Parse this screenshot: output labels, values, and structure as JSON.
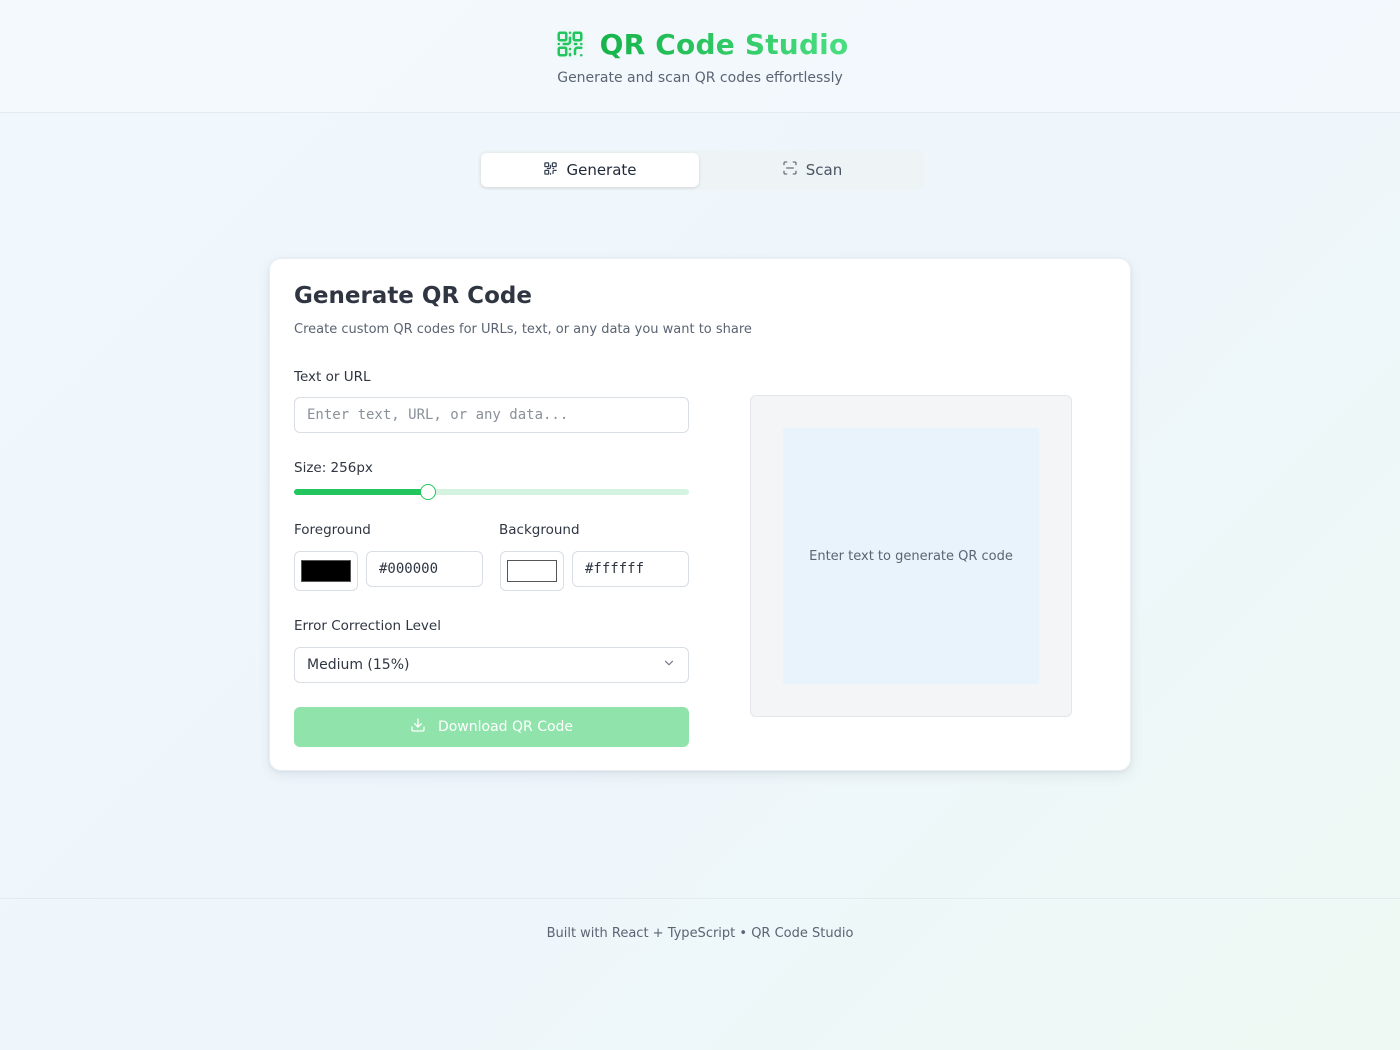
{
  "header": {
    "title": "QR Code Studio",
    "subtitle": "Generate and scan QR codes effortlessly",
    "brand_icon": "qr-code-icon",
    "accent_color": "#22c55e"
  },
  "tabs": [
    {
      "label": "Generate",
      "icon": "qr-code-icon",
      "active": true
    },
    {
      "label": "Scan",
      "icon": "scan-icon",
      "active": false
    }
  ],
  "generator": {
    "title": "Generate QR Code",
    "description": "Create custom QR codes for URLs, text, or any data you want to share",
    "text_label": "Text or URL",
    "text_value": "",
    "text_placeholder": "Enter text, URL, or any data...",
    "size_label": "Size: 256px",
    "size_slider_fraction": 0.34,
    "foreground_label": "Foreground",
    "foreground_value": "#000000",
    "background_label": "Background",
    "background_value": "#ffffff",
    "error_label": "Error Correction Level",
    "error_selected": "Medium (15%)",
    "download_label": "Download QR Code",
    "download_disabled": true
  },
  "preview": {
    "placeholder": "Enter text to generate QR code"
  },
  "footer": {
    "text": "Built with React + TypeScript • QR Code Studio"
  }
}
